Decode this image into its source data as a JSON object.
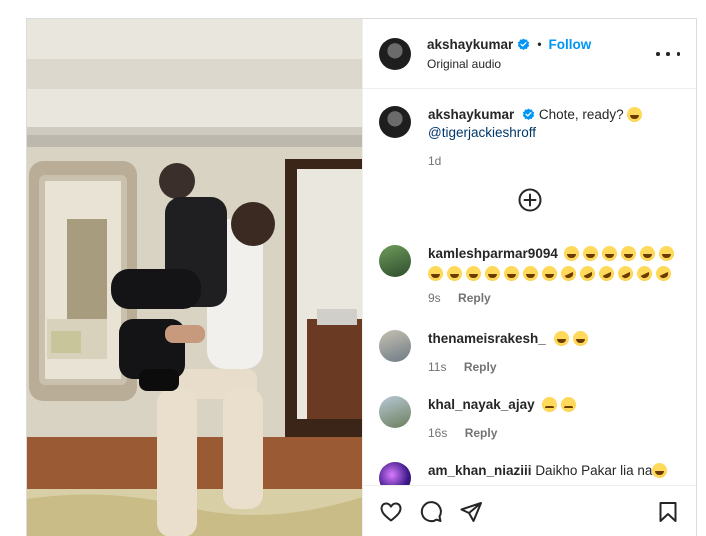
{
  "header": {
    "username": "akshaykumar",
    "separator": "•",
    "follow_label": "Follow",
    "audio": "Original audio"
  },
  "caption": {
    "username": "akshaykumar",
    "text": "Chote, ready?",
    "mention": "@tigerjackieshroff",
    "time": "1d"
  },
  "comments": [
    {
      "username": "kamleshparmar9094",
      "text": "",
      "time": "9s",
      "reply_label": "Reply"
    },
    {
      "username": "thenameisrakesh_",
      "text": "",
      "time": "11s",
      "reply_label": "Reply"
    },
    {
      "username": "khal_nayak_ajay",
      "text": "",
      "time": "16s",
      "reply_label": "Reply"
    },
    {
      "username": "am_khan_niaziii",
      "text": "Daikho Pakar lia na",
      "time": "",
      "reply_label": ""
    }
  ],
  "icons": {
    "more": "more-options-icon",
    "add_comment": "add-circle-icon",
    "like": "heart-icon",
    "comment": "comment-icon",
    "share": "send-icon",
    "save": "bookmark-icon"
  },
  "colors": {
    "accent": "#0095f6",
    "verified": "#0095f6",
    "secondary_text": "#737373"
  }
}
